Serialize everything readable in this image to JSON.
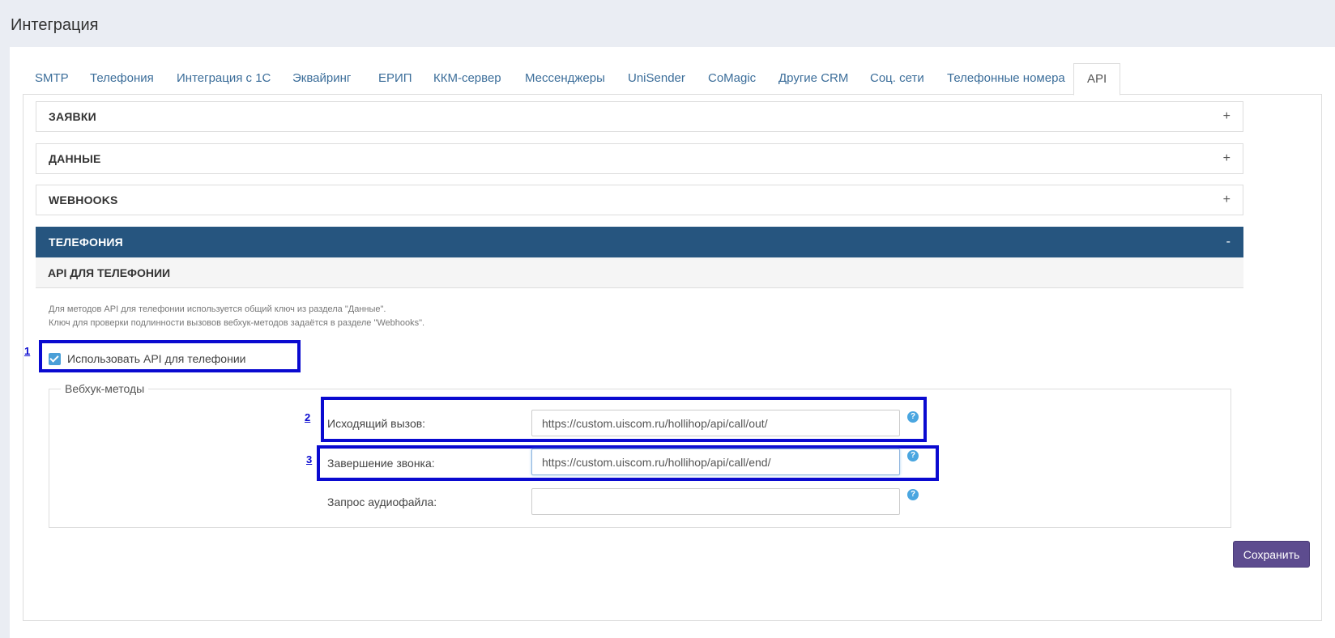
{
  "page": {
    "title": "Интеграция"
  },
  "tabs": [
    {
      "label": "SMTP"
    },
    {
      "label": "Телефония"
    },
    {
      "label": "Интеграция с 1С"
    },
    {
      "label": "Эквайринг"
    },
    {
      "label": "ЕРИП"
    },
    {
      "label": "ККМ-сервер"
    },
    {
      "label": "Мессенджеры"
    },
    {
      "label": "UniSender"
    },
    {
      "label": "CoMagic"
    },
    {
      "label": "Другие CRM"
    },
    {
      "label": "Соц. сети"
    },
    {
      "label": "Телефонные номера"
    },
    {
      "label": "API",
      "active": true
    }
  ],
  "panels": {
    "zayavki": {
      "title": "ЗАЯВКИ",
      "toggle": "+"
    },
    "dannye": {
      "title": "ДАННЫЕ",
      "toggle": "+"
    },
    "webhooks": {
      "title": "WEBHOOKS",
      "toggle": "+"
    },
    "telephony": {
      "title": "ТЕЛЕФОНИЯ",
      "toggle": "-"
    }
  },
  "telephony_api": {
    "subheader": "API ДЛЯ ТЕЛЕФОНИИ",
    "note_line1": "Для методов API для телефонии используется общий ключ из раздела \"Данные\".",
    "note_line2": "Ключ для проверки подлинности вызовов вебхук-методов задаётся в разделе \"Webhooks\".",
    "use_api_label": "Использовать API для телефонии",
    "use_api_checked": true,
    "fieldset_legend": "Вебхук-методы",
    "rows": [
      {
        "label": "Исходящий вызов:",
        "value": "https://custom.uiscom.ru/hollihop/api/call/out/"
      },
      {
        "label": "Завершение звонка:",
        "value": "https://custom.uiscom.ru/hollihop/api/call/end/"
      },
      {
        "label": "Запрос аудиофайла:",
        "value": ""
      }
    ],
    "help_glyph": "?",
    "save_label": "Сохранить"
  },
  "annotations": [
    "1",
    "2",
    "3"
  ],
  "colors": {
    "accent": "#26557f",
    "highlight": "#0a0ad0",
    "save_button": "#5d4c8f",
    "link": "#3c6e9a"
  }
}
